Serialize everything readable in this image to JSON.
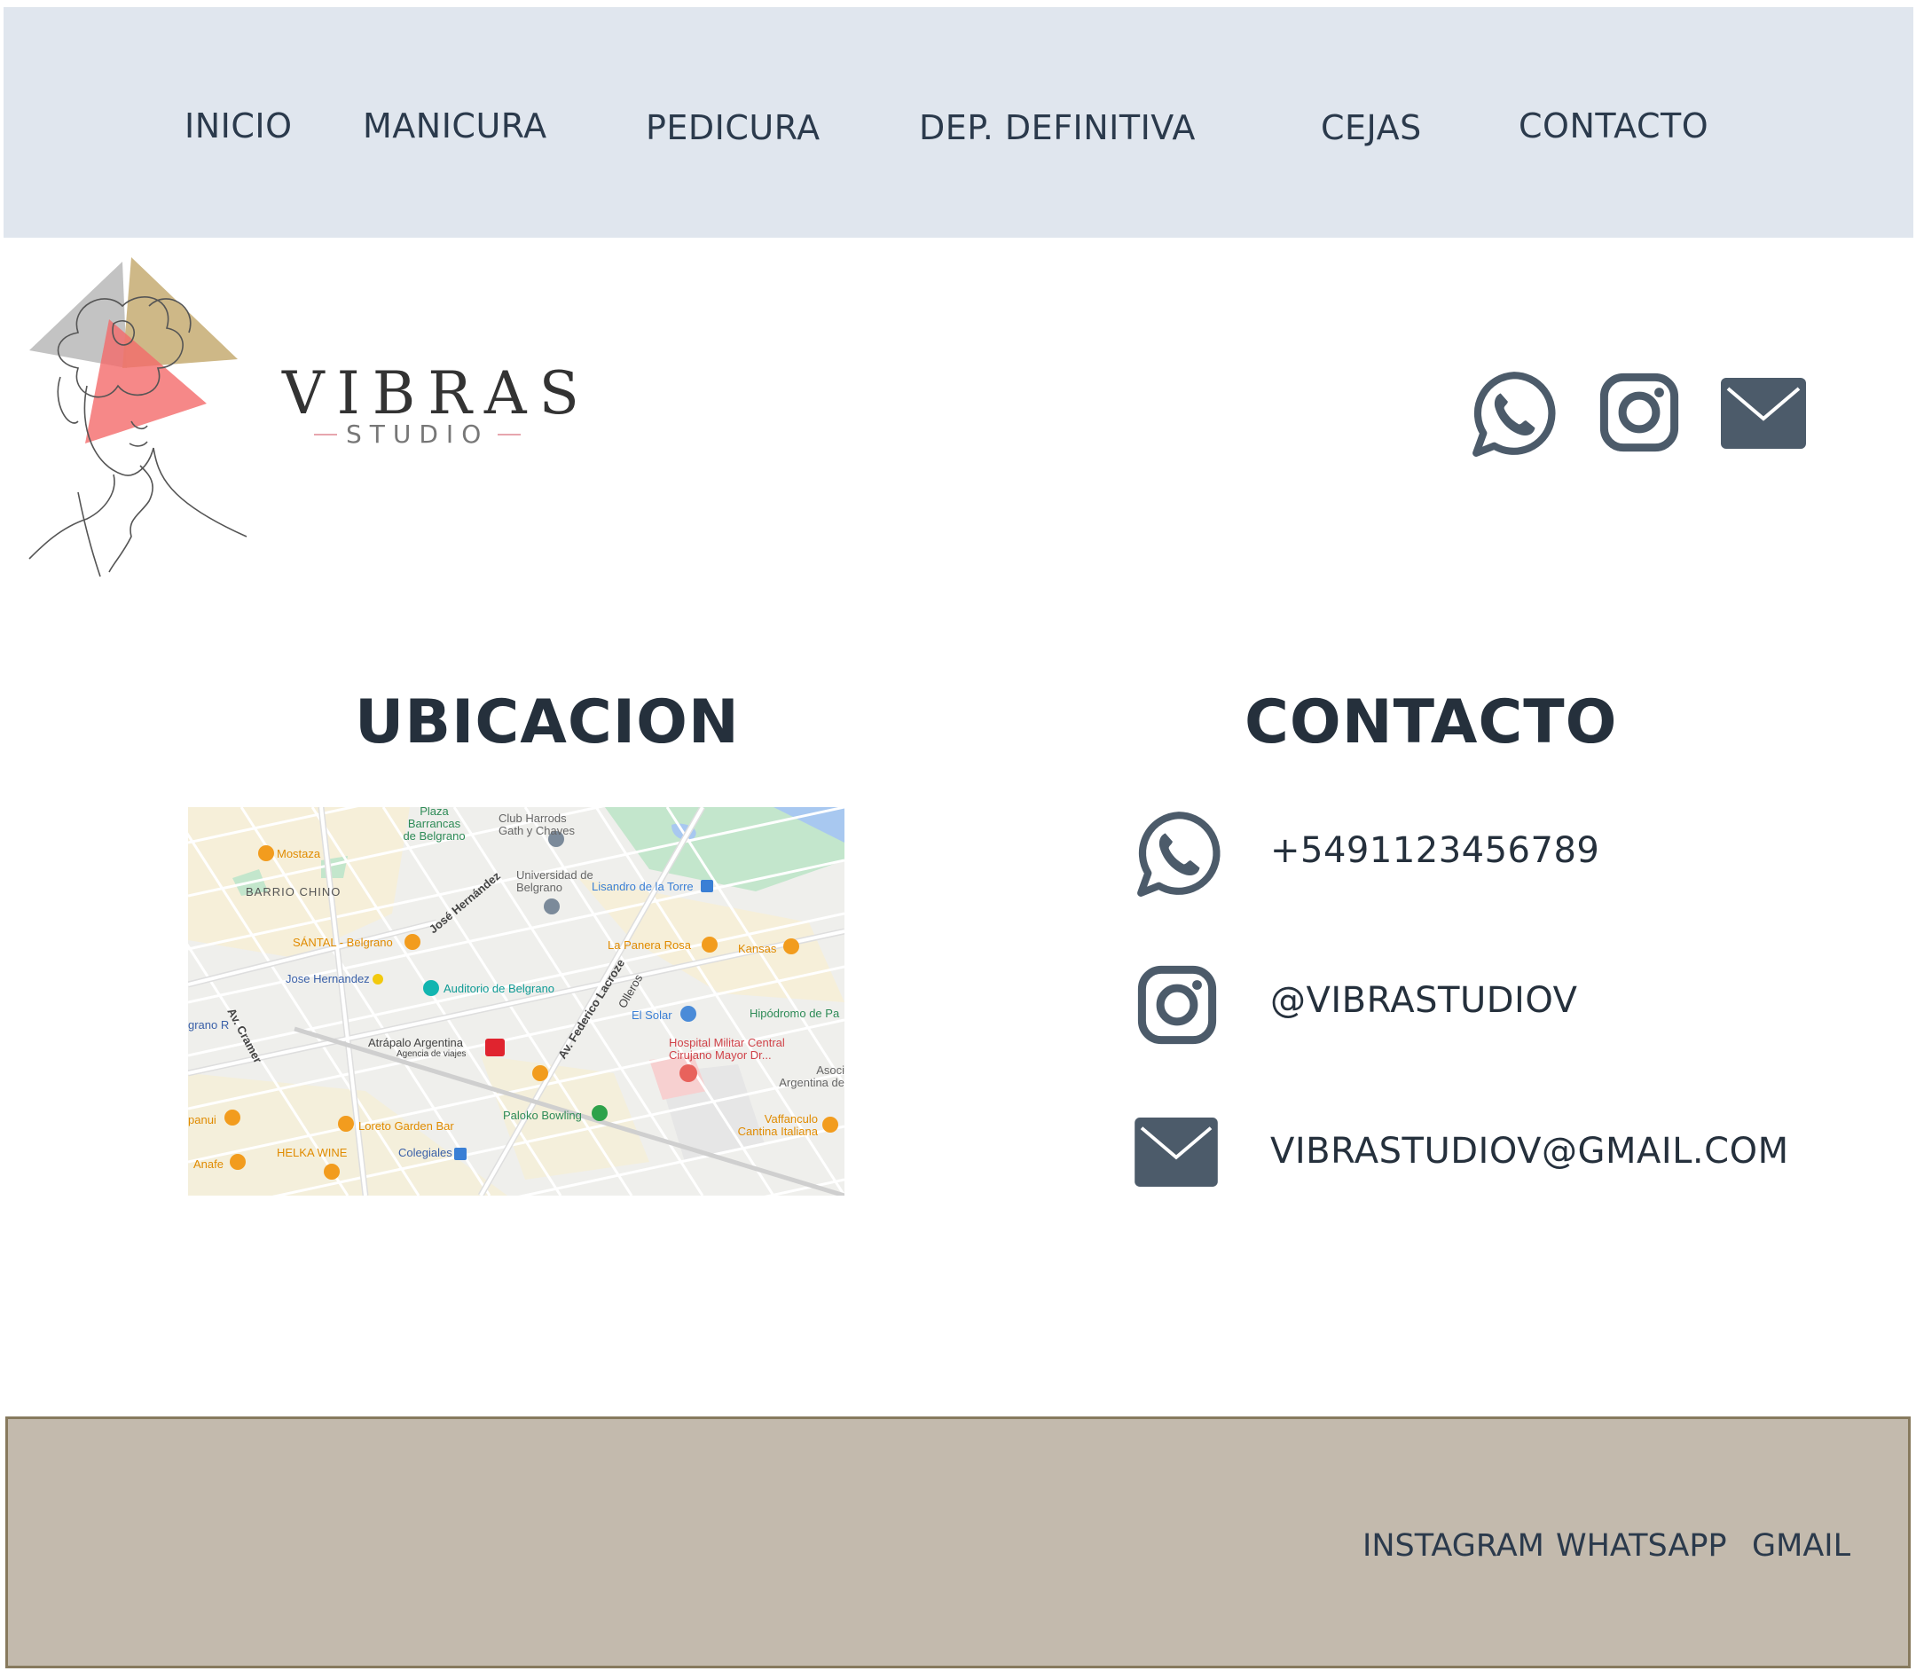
{
  "nav": {
    "items": [
      "INICIO",
      "MANICURA",
      "PEDICURA",
      "DEP. DEFINITIVA",
      "CEJAS",
      "CONTACTO"
    ]
  },
  "brand": {
    "name": "VIBRAS",
    "sub": "STUDIO"
  },
  "header_icons": [
    "whatsapp-icon",
    "instagram-icon",
    "mail-icon"
  ],
  "ubicacion": {
    "title": "UBICACION",
    "map_labels": [
      "Plaza Barrancas de Belgrano",
      "Club Harrods Gath y Chaves",
      "Mostaza",
      "BARRIO CHINO",
      "Universidad de Belgrano",
      "Lisandro de la Torre",
      "José Hernández",
      "SÁNTAL - Belgrano",
      "La Panera Rosa",
      "Kansas",
      "Jose Hernandez",
      "Auditorio de Belgrano",
      "Av. Federico Lacroze",
      "Olleros",
      "El Solar",
      "Hipódromo de Pa",
      "Av. Cramer",
      "Atrápalo Argentina",
      "Agencia de viajes",
      "Hospital Militar Central Cirujano Mayor Dr...",
      "Asoci Argentina de",
      "Paloko Bowling",
      "Loreto Garden Bar",
      "Vaffanculo Cantina Italiana",
      "HELKA WINE",
      "Colegiales",
      "Anafe",
      "panui",
      "grano R"
    ]
  },
  "contacto": {
    "title": "CONTACTO",
    "phone": "+5491123456789",
    "instagram": "@VIBRASTUDIOV",
    "email": "VIBRASTUDIOV@GMAIL.COM"
  },
  "footer": {
    "links": [
      "INSTAGRAM",
      "WHATSAPP",
      "GMAIL"
    ]
  },
  "colors": {
    "nav_bg": "#e0e6ee",
    "icon": "#4c5b6a",
    "footer_bg": "#c3baad",
    "text": "#25303c"
  }
}
